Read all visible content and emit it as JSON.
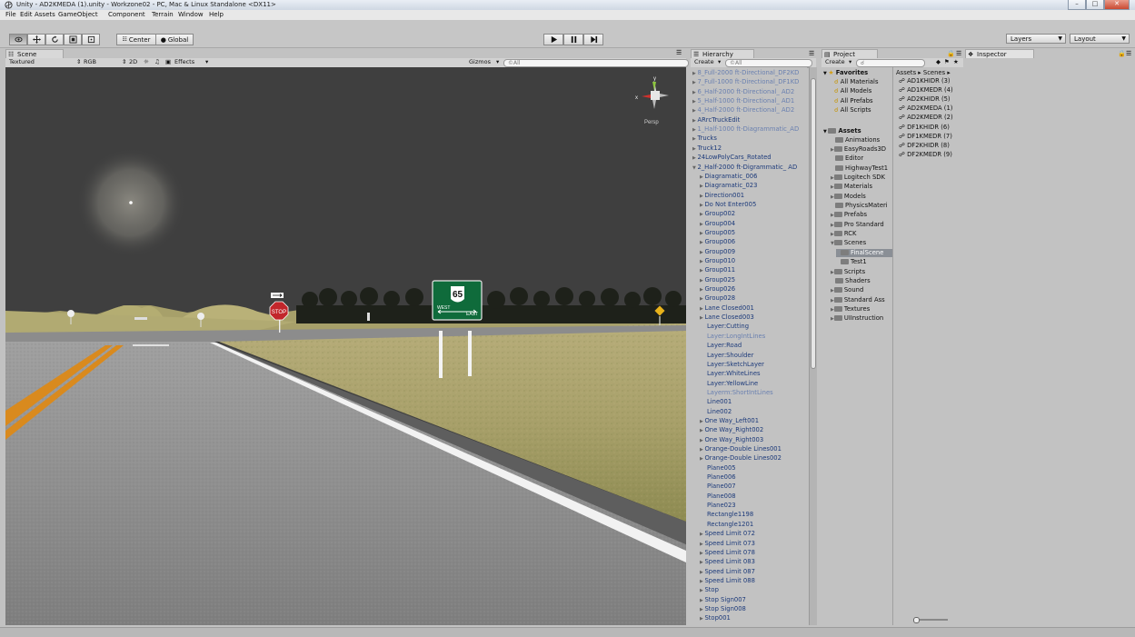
{
  "window": {
    "title": "Unity - AD2KMEDA (1).unity - Workzone02 - PC, Mac & Linux Standalone <DX11>",
    "buttons": [
      "–",
      "□",
      "✕"
    ]
  },
  "menu": [
    "File",
    "Edit",
    "Assets",
    "GameObject",
    "Component",
    "Terrain",
    "Window",
    "Help"
  ],
  "toolbar": {
    "center_label": "Center",
    "global_label": "Global",
    "layers_label": "Layers",
    "layout_label": "Layout"
  },
  "scene": {
    "tab": "Scene",
    "shading": "Textured",
    "rgb": "RGB",
    "mode_2d": "2D",
    "effects": "Effects",
    "gizmos": "Gizmos",
    "search_placeholder": "©All",
    "persp_label": "Persp",
    "axis_y": "y",
    "axis_x": "x",
    "stop_text": "STOP",
    "sign_route": "65",
    "sign_west": "WEST",
    "sign_east": "EAST"
  },
  "hierarchy": {
    "tab": "Hierarchy",
    "create": "Create",
    "search_placeholder": "©All",
    "rows": [
      {
        "label": "8_Full-2000 ft-Directional_DF2KD",
        "arrow": true,
        "dim": true,
        "indent": 0
      },
      {
        "label": "7_Full-1000 ft-Directional_DF1KD",
        "arrow": true,
        "dim": true,
        "indent": 0
      },
      {
        "label": "6_Half-2000 ft-Directional_ AD2",
        "arrow": true,
        "dim": true,
        "indent": 0
      },
      {
        "label": "5_Half-1000 ft-Directional_ AD1",
        "arrow": true,
        "dim": true,
        "indent": 0
      },
      {
        "label": "4_Half-2000 ft-Directional_ AD2",
        "arrow": true,
        "dim": true,
        "indent": 0
      },
      {
        "label": "ARrcTruckEdit",
        "arrow": true,
        "dim": false,
        "indent": 0
      },
      {
        "label": "1_Half-1000 ft-Diagrammatic_AD",
        "arrow": true,
        "dim": true,
        "indent": 0
      },
      {
        "label": "Trucks",
        "arrow": true,
        "dim": false,
        "indent": 0
      },
      {
        "label": "Truck12",
        "arrow": true,
        "dim": false,
        "indent": 0
      },
      {
        "label": "24LowPolyCars_Rotated",
        "arrow": true,
        "dim": false,
        "indent": 0
      },
      {
        "label": "2_Half-2000 ft-Digrammatic_ AD",
        "arrow": true,
        "open": true,
        "dim": false,
        "indent": 0
      },
      {
        "label": "Diagramatic_006",
        "arrow": true,
        "dim": false,
        "indent": 1
      },
      {
        "label": "Diagramatic_023",
        "arrow": true,
        "dim": false,
        "indent": 1
      },
      {
        "label": "Direction001",
        "arrow": true,
        "dim": false,
        "indent": 1
      },
      {
        "label": "Do Not Enter005",
        "arrow": true,
        "dim": false,
        "indent": 1
      },
      {
        "label": "Group002",
        "arrow": true,
        "dim": false,
        "indent": 1
      },
      {
        "label": "Group004",
        "arrow": true,
        "dim": false,
        "indent": 1
      },
      {
        "label": "Group005",
        "arrow": true,
        "dim": false,
        "indent": 1
      },
      {
        "label": "Group006",
        "arrow": true,
        "dim": false,
        "indent": 1
      },
      {
        "label": "Group009",
        "arrow": true,
        "dim": false,
        "indent": 1
      },
      {
        "label": "Group010",
        "arrow": true,
        "dim": false,
        "indent": 1
      },
      {
        "label": "Group011",
        "arrow": true,
        "dim": false,
        "indent": 1
      },
      {
        "label": "Group025",
        "arrow": true,
        "dim": false,
        "indent": 1
      },
      {
        "label": "Group026",
        "arrow": true,
        "dim": false,
        "indent": 1
      },
      {
        "label": "Group028",
        "arrow": true,
        "dim": false,
        "indent": 1
      },
      {
        "label": "Lane Closed001",
        "arrow": true,
        "dim": false,
        "indent": 1
      },
      {
        "label": "Lane Closed003",
        "arrow": true,
        "dim": false,
        "indent": 1
      },
      {
        "label": "Layer:Cutting",
        "arrow": false,
        "dim": false,
        "indent": 1
      },
      {
        "label": "Layer:LongIntLines",
        "arrow": false,
        "dim": true,
        "indent": 1
      },
      {
        "label": "Layer:Road",
        "arrow": false,
        "dim": false,
        "indent": 1
      },
      {
        "label": "Layer:Shoulder",
        "arrow": false,
        "dim": false,
        "indent": 1
      },
      {
        "label": "Layer:SketchLayer",
        "arrow": false,
        "dim": false,
        "indent": 1
      },
      {
        "label": "Layer:WhiteLines",
        "arrow": false,
        "dim": false,
        "indent": 1
      },
      {
        "label": "Layer:YellowLine",
        "arrow": false,
        "dim": false,
        "indent": 1
      },
      {
        "label": "Layerm:ShortIntLines",
        "arrow": false,
        "dim": true,
        "indent": 1
      },
      {
        "label": "Line001",
        "arrow": false,
        "dim": false,
        "indent": 1
      },
      {
        "label": "Line002",
        "arrow": false,
        "dim": false,
        "indent": 1
      },
      {
        "label": "One Way_Left001",
        "arrow": true,
        "dim": false,
        "indent": 1
      },
      {
        "label": "One Way_Right002",
        "arrow": true,
        "dim": false,
        "indent": 1
      },
      {
        "label": "One Way_Right003",
        "arrow": true,
        "dim": false,
        "indent": 1
      },
      {
        "label": "Orange-Double Lines001",
        "arrow": true,
        "dim": false,
        "indent": 1
      },
      {
        "label": "Orange-Double Lines002",
        "arrow": true,
        "dim": false,
        "indent": 1
      },
      {
        "label": "Plane005",
        "arrow": false,
        "dim": false,
        "indent": 1
      },
      {
        "label": "Plane006",
        "arrow": false,
        "dim": false,
        "indent": 1
      },
      {
        "label": "Plane007",
        "arrow": false,
        "dim": false,
        "indent": 1
      },
      {
        "label": "Plane008",
        "arrow": false,
        "dim": false,
        "indent": 1
      },
      {
        "label": "Plane023",
        "arrow": false,
        "dim": false,
        "indent": 1
      },
      {
        "label": "Rectangle1198",
        "arrow": false,
        "dim": false,
        "indent": 1
      },
      {
        "label": "Rectangle1201",
        "arrow": false,
        "dim": false,
        "indent": 1
      },
      {
        "label": "Speed Limit 072",
        "arrow": true,
        "dim": false,
        "indent": 1
      },
      {
        "label": "Speed Limit 073",
        "arrow": true,
        "dim": false,
        "indent": 1
      },
      {
        "label": "Speed Limit 078",
        "arrow": true,
        "dim": false,
        "indent": 1
      },
      {
        "label": "Speed Limit 083",
        "arrow": true,
        "dim": false,
        "indent": 1
      },
      {
        "label": "Speed Limit 087",
        "arrow": true,
        "dim": false,
        "indent": 1
      },
      {
        "label": "Speed Limit 088",
        "arrow": true,
        "dim": false,
        "indent": 1
      },
      {
        "label": "Stop",
        "arrow": true,
        "dim": false,
        "indent": 1
      },
      {
        "label": "Stop Sign007",
        "arrow": true,
        "dim": false,
        "indent": 1
      },
      {
        "label": "Stop Sign008",
        "arrow": true,
        "dim": false,
        "indent": 1
      },
      {
        "label": "Stop001",
        "arrow": true,
        "dim": false,
        "indent": 1
      }
    ]
  },
  "project": {
    "tab": "Project",
    "create": "Create",
    "breadcrumb_assets": "Assets",
    "breadcrumb_scenes": "Scenes",
    "favorites": {
      "label": "Favorites",
      "items": [
        "All Materials",
        "All Models",
        "All Prefabs",
        "All Scripts"
      ]
    },
    "assets": {
      "label": "Assets",
      "folders": [
        {
          "label": "Animations",
          "arrow": false,
          "indent": 1
        },
        {
          "label": "EasyRoads3D",
          "arrow": true,
          "indent": 1
        },
        {
          "label": "Editor",
          "arrow": false,
          "indent": 1
        },
        {
          "label": "HighwayTest1",
          "arrow": false,
          "indent": 1
        },
        {
          "label": "Logitech SDK",
          "arrow": true,
          "indent": 1
        },
        {
          "label": "Materials",
          "arrow": true,
          "indent": 1
        },
        {
          "label": "Models",
          "arrow": true,
          "indent": 1
        },
        {
          "label": "PhysicsMateri",
          "arrow": false,
          "indent": 1
        },
        {
          "label": "Prefabs",
          "arrow": true,
          "indent": 1
        },
        {
          "label": "Pro Standard",
          "arrow": true,
          "indent": 1
        },
        {
          "label": "RCK",
          "arrow": true,
          "indent": 1
        },
        {
          "label": "Scenes",
          "arrow": true,
          "open": true,
          "indent": 1
        },
        {
          "label": "FinalScene",
          "arrow": false,
          "indent": 2,
          "selected": true
        },
        {
          "label": "Test1",
          "arrow": false,
          "indent": 2
        },
        {
          "label": "Scripts",
          "arrow": true,
          "indent": 1
        },
        {
          "label": "Shaders",
          "arrow": false,
          "indent": 1
        },
        {
          "label": "Sound",
          "arrow": true,
          "indent": 1
        },
        {
          "label": "Standard Ass",
          "arrow": true,
          "indent": 1
        },
        {
          "label": "Textures",
          "arrow": true,
          "indent": 1
        },
        {
          "label": "UIInstruction",
          "arrow": true,
          "indent": 1
        }
      ]
    },
    "scene_files": [
      "AD1KHIDR (3)",
      "AD1KMEDR (4)",
      "AD2KHIDR (5)",
      "AD2KMEDA (1)",
      "AD2KMEDR (2)",
      "DF1KHIDR (6)",
      "DF1KMEDR (7)",
      "DF2KHIDR (8)",
      "DF2KMEDR (9)"
    ]
  },
  "inspector": {
    "tab": "Inspector"
  },
  "colors": {
    "panel": "#c2c2c2",
    "sky": "#3f3f3f",
    "grass": "#b8b27a",
    "road": "#8e8e8e",
    "hierarchy_text": "#1c3a7a",
    "sign_green": "#0f6b3b",
    "stop_red": "#c2262b"
  }
}
